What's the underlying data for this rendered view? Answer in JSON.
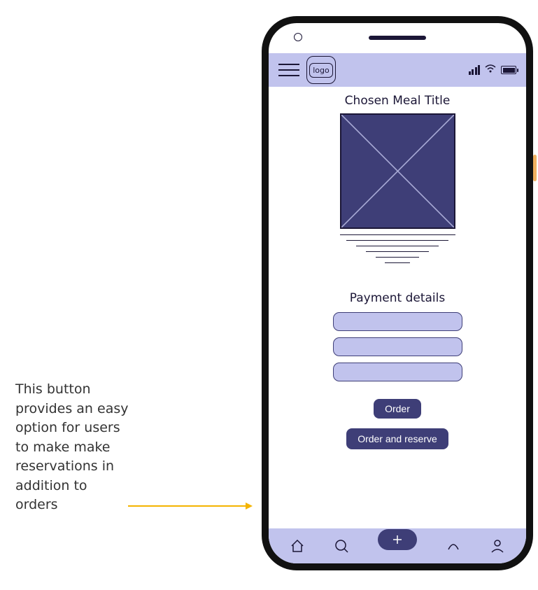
{
  "annotation": {
    "text": "This button provides an easy option for users to make make reservations in addition to orders"
  },
  "header": {
    "logo_label": "logo"
  },
  "content": {
    "meal_title": "Chosen Meal Title",
    "payment_title": "Payment details"
  },
  "actions": {
    "order_label": "Order",
    "order_reserve_label": "Order and reserve"
  }
}
